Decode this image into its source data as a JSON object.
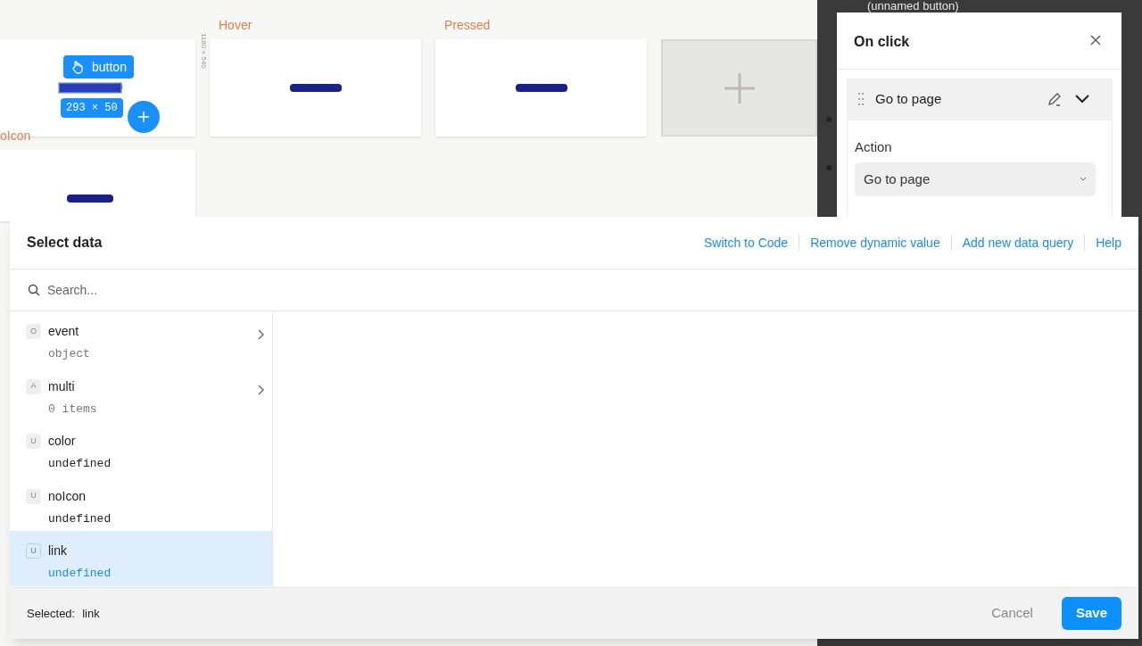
{
  "canvas": {
    "frames": [
      {
        "label": "Hover"
      },
      {
        "label": "Pressed"
      }
    ],
    "row2_label": "oIcon",
    "frame_size": "1180 × 540",
    "selection": {
      "label": "button",
      "size": "293 × 50"
    }
  },
  "side_panel": {
    "header_text": "(unnamed button)",
    "title": "On click",
    "action_row": {
      "title": "Go to page",
      "expanded": true
    },
    "field_label": "Action",
    "field_value": "Go to page"
  },
  "modal": {
    "title": "Select data",
    "links": [
      "Switch to Code",
      "Remove dynamic value",
      "Add new data query",
      "Help"
    ],
    "search_placeholder": "Search...",
    "items": [
      {
        "badge": "O",
        "name": "event",
        "value": "object",
        "has_children": true,
        "selected": false
      },
      {
        "badge": "A",
        "name": "multi",
        "value": "0 items",
        "has_children": true,
        "selected": false
      },
      {
        "badge": "U",
        "name": "color",
        "value": "undefined",
        "has_children": false,
        "selected": false
      },
      {
        "badge": "U",
        "name": "noIcon",
        "value": "undefined",
        "has_children": false,
        "selected": false
      },
      {
        "badge": "U",
        "name": "link",
        "value": "undefined",
        "has_children": false,
        "selected": true
      }
    ],
    "footer": {
      "selected_label": "Selected:",
      "selected_value": "link"
    },
    "buttons": {
      "cancel": "Cancel",
      "save": "Save"
    }
  }
}
